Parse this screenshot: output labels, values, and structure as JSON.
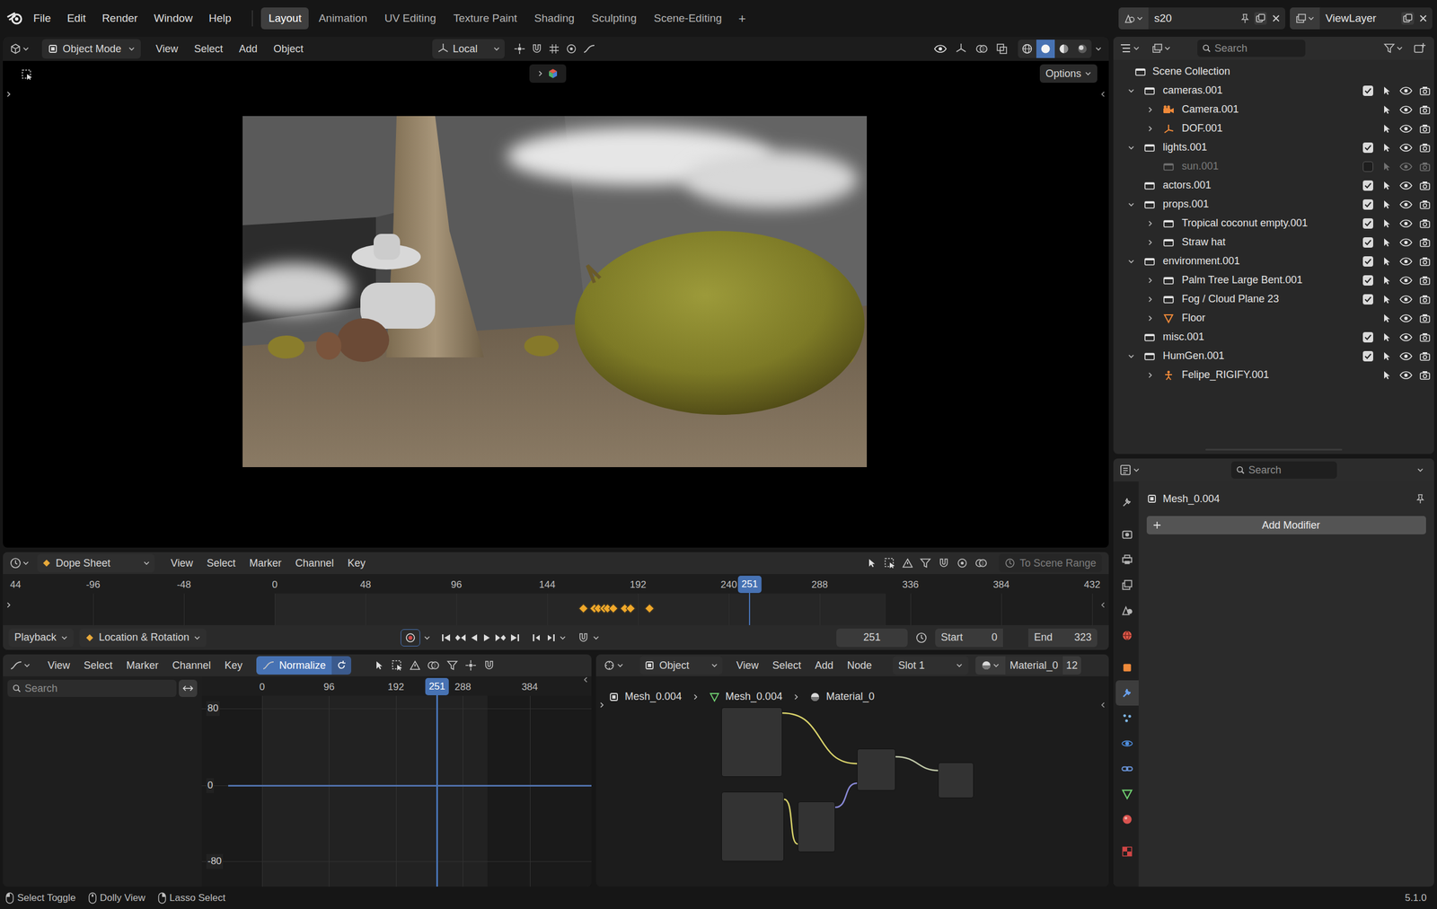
{
  "topbar": {
    "menus": [
      "File",
      "Edit",
      "Render",
      "Window",
      "Help"
    ],
    "workspaces": [
      {
        "label": "Layout",
        "selected": true
      },
      {
        "label": "Animation",
        "selected": false
      },
      {
        "label": "UV Editing",
        "selected": false
      },
      {
        "label": "Texture Paint",
        "selected": false
      },
      {
        "label": "Shading",
        "selected": false
      },
      {
        "label": "Sculpting",
        "selected": false
      },
      {
        "label": "Scene-Editing",
        "selected": false
      }
    ],
    "add_workspace": "+",
    "scene": "s20",
    "view_layer": "ViewLayer"
  },
  "viewport": {
    "mode": "Object Mode",
    "menus": [
      "View",
      "Select",
      "Add",
      "Object"
    ],
    "orientation": "Local",
    "options": "Options",
    "shading": [
      {
        "kind": "wireframe",
        "selected": false
      },
      {
        "kind": "solid",
        "selected": true
      },
      {
        "kind": "material",
        "selected": false
      },
      {
        "kind": "rendered",
        "selected": false
      }
    ]
  },
  "outliner": {
    "search": {
      "placeholder": "Search"
    },
    "root": "Scene Collection",
    "rows": [
      {
        "label": "cameras.001",
        "depth": 0,
        "kind": "collection",
        "expandable": true,
        "expanded": true,
        "checked": true,
        "disabled": false
      },
      {
        "label": "Camera.001",
        "depth": 1,
        "kind": "camera",
        "expandable": true,
        "expanded": false,
        "disabled": false
      },
      {
        "label": "DOF.001",
        "depth": 1,
        "kind": "empty",
        "expandable": true,
        "expanded": false,
        "disabled": false
      },
      {
        "label": "lights.001",
        "depth": 0,
        "kind": "collection",
        "expandable": true,
        "expanded": true,
        "checked": true,
        "disabled": false
      },
      {
        "label": "sun.001",
        "depth": 1,
        "kind": "collection",
        "expandable": false,
        "expanded": false,
        "checked": false,
        "disabled": true
      },
      {
        "label": "actors.001",
        "depth": 0,
        "kind": "collection",
        "expandable": false,
        "expanded": false,
        "checked": true,
        "disabled": false
      },
      {
        "label": "props.001",
        "depth": 0,
        "kind": "collection",
        "expandable": true,
        "expanded": true,
        "checked": true,
        "disabled": false
      },
      {
        "label": "Tropical coconut empty.001",
        "depth": 1,
        "kind": "collection",
        "expandable": true,
        "expanded": false,
        "checked": true,
        "disabled": false
      },
      {
        "label": "Straw hat",
        "depth": 1,
        "kind": "collection",
        "expandable": true,
        "expanded": false,
        "checked": true,
        "disabled": false
      },
      {
        "label": "environment.001",
        "depth": 0,
        "kind": "collection",
        "expandable": true,
        "expanded": true,
        "checked": true,
        "disabled": false
      },
      {
        "label": "Palm Tree Large Bent.001",
        "depth": 1,
        "kind": "collection",
        "expandable": true,
        "expanded": false,
        "checked": true,
        "disabled": false
      },
      {
        "label": "Fog / Cloud Plane 23",
        "depth": 1,
        "kind": "collection",
        "expandable": true,
        "expanded": false,
        "checked": true,
        "disabled": false
      },
      {
        "label": "Floor",
        "depth": 1,
        "kind": "mesh",
        "expandable": true,
        "expanded": false,
        "disabled": false
      },
      {
        "label": "misc.001",
        "depth": 0,
        "kind": "collection",
        "expandable": false,
        "expanded": false,
        "checked": true,
        "disabled": false
      },
      {
        "label": "HumGen.001",
        "depth": 0,
        "kind": "collection",
        "expandable": true,
        "expanded": true,
        "checked": true,
        "disabled": false
      },
      {
        "label": "Felipe_RIGIFY.001",
        "depth": 1,
        "kind": "armature",
        "expandable": true,
        "expanded": false,
        "disabled": false
      }
    ]
  },
  "properties": {
    "search": {
      "placeholder": "Search"
    },
    "object": "Mesh_0.004",
    "add_modifier": "Add Modifier",
    "tabs": [
      {
        "kind": "tool",
        "selected": false
      },
      {
        "kind": "render",
        "selected": false
      },
      {
        "kind": "output",
        "selected": false
      },
      {
        "kind": "view_layer",
        "selected": false
      },
      {
        "kind": "scene",
        "selected": false
      },
      {
        "kind": "world",
        "selected": false
      },
      {
        "kind": "object",
        "selected": false
      },
      {
        "kind": "modifiers",
        "selected": true
      },
      {
        "kind": "particles",
        "selected": false
      },
      {
        "kind": "physics",
        "selected": false
      },
      {
        "kind": "constraints",
        "selected": false
      },
      {
        "kind": "data",
        "selected": false
      },
      {
        "kind": "material",
        "selected": false
      },
      {
        "kind": "texture",
        "selected": false
      }
    ]
  },
  "dopesheet": {
    "mode": "Dope Sheet",
    "menus": [
      "View",
      "Select",
      "Marker",
      "Channel",
      "Key"
    ],
    "scene_range": {
      "label": "To Scene Range",
      "disabled": true
    },
    "ticks": [
      "44",
      "-96",
      "-48",
      "0",
      "48",
      "96",
      "144",
      "192",
      "240",
      "288",
      "336",
      "384",
      "432"
    ],
    "current_frame": "251",
    "keyframes": [
      163,
      169,
      171,
      174,
      176,
      179,
      185,
      188,
      198
    ]
  },
  "playback": {
    "menu": "Playback",
    "keying_set": "Location & Rotation",
    "auto_key": false,
    "frame": "251",
    "start_label": "Start",
    "start": "0",
    "end_label": "End",
    "end": "323"
  },
  "graph_editor": {
    "menus": [
      "View",
      "Select",
      "Marker",
      "Channel",
      "Key"
    ],
    "normalize": {
      "label": "Normalize",
      "selected": true
    },
    "search": {
      "placeholder": "Search"
    },
    "ticks": [
      "0",
      "96",
      "192",
      "288",
      "384"
    ],
    "current_frame": "251",
    "value_ticks": [
      "80",
      "0",
      "-80"
    ]
  },
  "node_editor": {
    "type": "Object",
    "menus": [
      "View",
      "Select",
      "Add",
      "Node"
    ],
    "slot": "Slot 1",
    "material": "Material_0",
    "users": "12",
    "breadcrumb": [
      "Mesh_0.004",
      "Mesh_0.004",
      "Material_0"
    ],
    "nodes": [
      {
        "kind": "image_texture"
      },
      {
        "kind": "image_texture"
      },
      {
        "kind": "normal_map"
      },
      {
        "kind": "principled_bsdf"
      },
      {
        "kind": "material_output"
      }
    ]
  },
  "status_bar": {
    "items": [
      "Select Toggle",
      "Dolly View",
      "Lasso Select"
    ],
    "version": "5.1.0"
  }
}
